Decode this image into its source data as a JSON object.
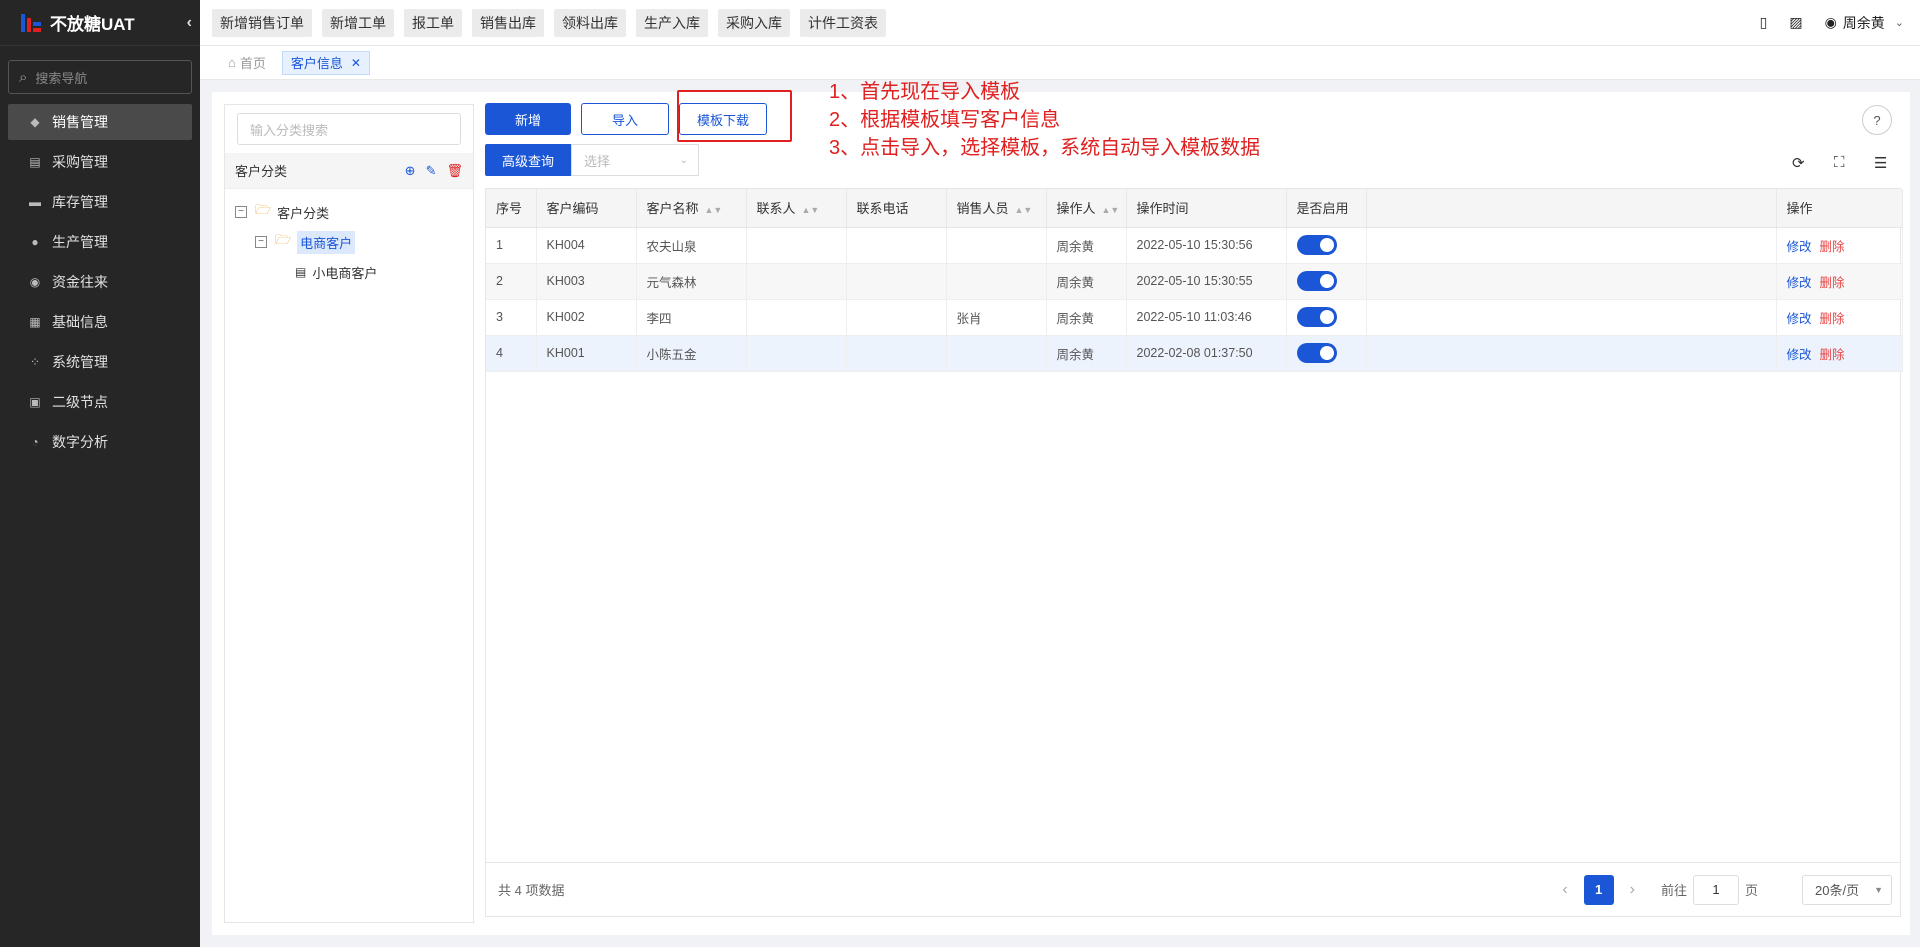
{
  "app": {
    "title": "不放糖UAT",
    "collapse_icon": "chevron-left-icon"
  },
  "sidebar": {
    "search_placeholder": "搜索导航",
    "items": [
      {
        "label": "销售管理",
        "icon": "tag-icon",
        "active": true
      },
      {
        "label": "采购管理",
        "icon": "cart-icon"
      },
      {
        "label": "库存管理",
        "icon": "warehouse-icon"
      },
      {
        "label": "生产管理",
        "icon": "factory-icon"
      },
      {
        "label": "资金往来",
        "icon": "money-icon"
      },
      {
        "label": "基础信息",
        "icon": "grid-icon"
      },
      {
        "label": "系统管理",
        "icon": "apps-icon"
      },
      {
        "label": "二级节点",
        "icon": "list-icon"
      },
      {
        "label": "数字分析",
        "icon": "pie-icon"
      }
    ]
  },
  "topbar": {
    "quick_links": [
      "新增销售订单",
      "新增工单",
      "报工单",
      "销售出库",
      "领料出库",
      "生产入库",
      "采购入库",
      "计件工资表"
    ],
    "user": "周余黄"
  },
  "tags": [
    {
      "label": "首页",
      "icon": "home-icon"
    },
    {
      "label": "客户信息",
      "active": true
    }
  ],
  "tree": {
    "search_placeholder": "输入分类搜索",
    "header": "客户分类",
    "nodes": [
      {
        "label": "客户分类",
        "level": 0
      },
      {
        "label": "电商客户",
        "level": 1,
        "highlight": true
      },
      {
        "label": "小电商客户",
        "level": 2
      }
    ]
  },
  "toolbar": {
    "add": "新增",
    "import": "导入",
    "template_download": "模板下载",
    "advanced_search": "高级查询",
    "select_placeholder": "选择"
  },
  "annotation": {
    "lines": [
      "1、首先现在导入模板",
      "2、根据模板填写客户信息",
      "3、点击导入，选择模板，系统自动导入模板数据"
    ]
  },
  "table": {
    "columns": [
      "序号",
      "客户编码",
      "客户名称",
      "联系人",
      "联系电话",
      "销售人员",
      "操作人",
      "操作时间",
      "是否启用",
      "",
      "操作"
    ],
    "rows": [
      {
        "idx": "1",
        "code": "KH004",
        "name": "农夫山泉",
        "contact": "",
        "phone": "",
        "sales": "",
        "operator": "周余黄",
        "time": "2022-05-10 15:30:56",
        "enabled": true
      },
      {
        "idx": "2",
        "code": "KH003",
        "name": "元气森林",
        "contact": "",
        "phone": "",
        "sales": "",
        "operator": "周余黄",
        "time": "2022-05-10 15:30:55",
        "enabled": true
      },
      {
        "idx": "3",
        "code": "KH002",
        "name": "李四",
        "contact": "",
        "phone": "",
        "sales": "张肖",
        "operator": "周余黄",
        "time": "2022-05-10 11:03:46",
        "enabled": true
      },
      {
        "idx": "4",
        "code": "KH001",
        "name": "小陈五金",
        "contact": "",
        "phone": "",
        "sales": "",
        "operator": "周余黄",
        "time": "2022-02-08 01:37:50",
        "enabled": true
      }
    ],
    "actions": {
      "edit": "修改",
      "delete": "删除"
    }
  },
  "pager": {
    "total": "共 4 项数据",
    "current": "1",
    "goto": "前往",
    "goto_value": "1",
    "page_unit": "页",
    "page_size": "20条/页"
  },
  "colors": {
    "primary": "#1a56d6",
    "danger": "#e02020",
    "sidebar": "#262626"
  }
}
